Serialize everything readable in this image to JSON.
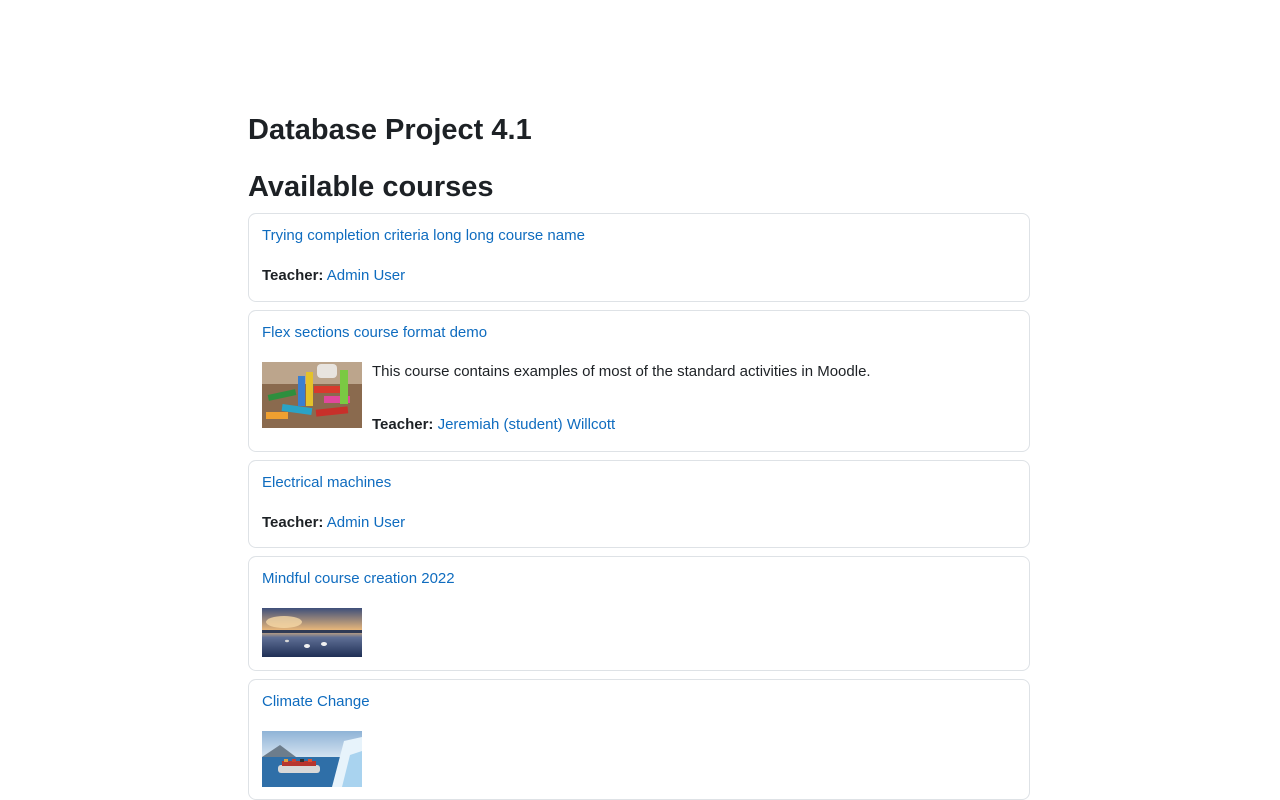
{
  "site": {
    "title": "Database Project 4.1"
  },
  "frontpage": {
    "section_title": "Available courses"
  },
  "courses": [
    {
      "name": "Trying completion criteria long long course name",
      "teacher_role": "Teacher:",
      "teacher_name": "Admin User"
    },
    {
      "name": "Flex sections course format demo",
      "summary": "This course contains examples of most of the standard activities in Moodle.",
      "teacher_role": "Teacher:",
      "teacher_name": "Jeremiah (student) Willcott",
      "image": "colorful-wooden-blocks-image"
    },
    {
      "name": "Electrical machines",
      "teacher_role": "Teacher:",
      "teacher_name": "Admin User"
    },
    {
      "name": "Mindful course creation 2022",
      "image": "sunset-lake-swans-image"
    },
    {
      "name": "Climate Change",
      "image": "icebergs-boat-image"
    }
  ],
  "colors": {
    "link": "#0f6cbf",
    "text": "#1d2125",
    "card_border": "#dee2e6"
  }
}
